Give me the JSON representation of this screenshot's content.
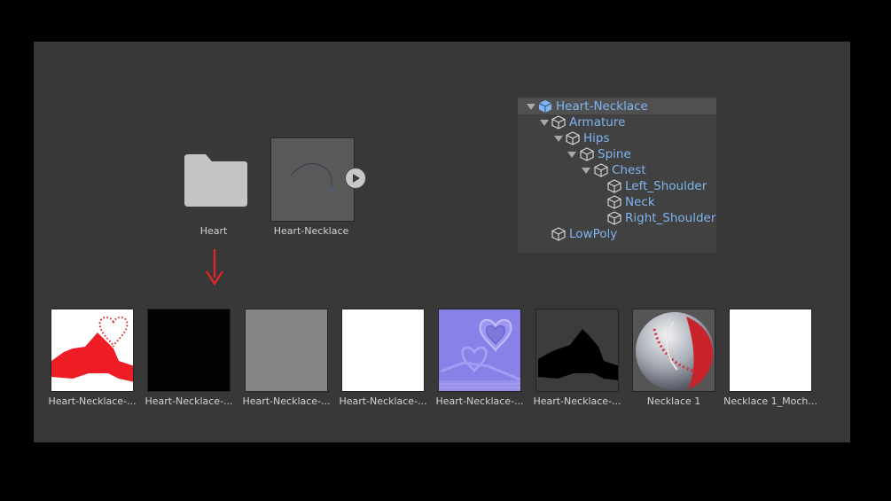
{
  "project": {
    "folder": {
      "label": "Heart",
      "icon": "folder-icon"
    },
    "prefab": {
      "label": "Heart-Necklace",
      "icon": "prefab-thumbnail"
    },
    "play_icon": "play-icon"
  },
  "hierarchy": {
    "items": [
      {
        "label": "Heart-Necklace",
        "icon": "prefab-cube-icon"
      },
      {
        "label": "Armature",
        "icon": "cube-icon"
      },
      {
        "label": "Hips",
        "icon": "cube-icon"
      },
      {
        "label": "Spine",
        "icon": "cube-icon"
      },
      {
        "label": "Chest",
        "icon": "cube-icon"
      },
      {
        "label": "Left_Shoulder",
        "icon": "cube-icon"
      },
      {
        "label": "Neck",
        "icon": "cube-icon"
      },
      {
        "label": "Right_Shoulder",
        "icon": "cube-icon"
      },
      {
        "label": "LowPoly",
        "icon": "cube-icon"
      }
    ]
  },
  "textures": [
    {
      "label": "Heart-Necklace-..."
    },
    {
      "label": "Heart-Necklace-..."
    },
    {
      "label": "Heart-Necklace-..."
    },
    {
      "label": "Heart-Necklace-..."
    },
    {
      "label": "Heart-Necklace-..."
    },
    {
      "label": "Heart-Necklace-..."
    },
    {
      "label": "Necklace 1"
    },
    {
      "label": "Necklace 1_Moch..."
    }
  ],
  "colors": {
    "panel": "#383838",
    "link_blue": "#7fb4f0",
    "arrow_red": "#e0242c",
    "texture_red": "#ee1c25"
  }
}
